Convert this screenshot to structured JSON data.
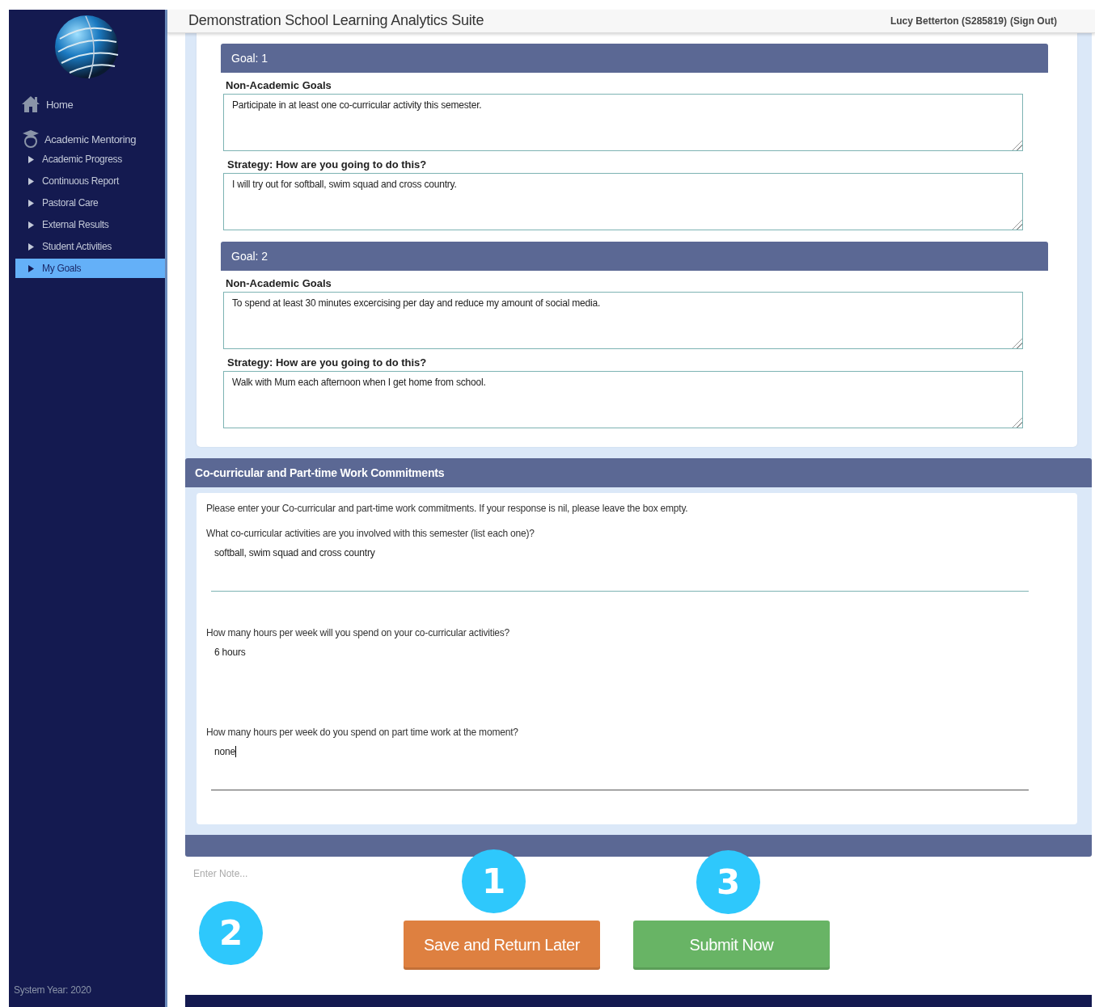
{
  "sidebar": {
    "items": [
      {
        "label": "Home",
        "kind": "home",
        "selected": false
      },
      {
        "label": "Academic Mentoring",
        "kind": "section",
        "selected": false
      },
      {
        "label": "Academic Progress",
        "kind": "sub",
        "selected": false
      },
      {
        "label": "Continuous Report",
        "kind": "sub",
        "selected": false
      },
      {
        "label": "Pastoral Care",
        "kind": "sub",
        "selected": false
      },
      {
        "label": "External Results",
        "kind": "sub",
        "selected": false
      },
      {
        "label": "Student Activities",
        "kind": "sub",
        "selected": false
      },
      {
        "label": "My Goals",
        "kind": "sub",
        "selected": true
      }
    ],
    "footer": "System Year: 2020"
  },
  "header": {
    "title": "Demonstration School Learning Analytics Suite",
    "user": "Lucy Betterton (S285819)",
    "sign_out": "Sign Out",
    "paren_open": "(",
    "paren_close": ")"
  },
  "goals": [
    {
      "title": "Goal: 1",
      "fields": [
        {
          "label": "Non-Academic Goals",
          "value": "Participate in at least one co-curricular activity this semester."
        },
        {
          "label": "Strategy: How are you going to do this?",
          "value": "I will try out for softball, swim squad and cross country."
        }
      ]
    },
    {
      "title": "Goal: 2",
      "fields": [
        {
          "label": "Non-Academic Goals",
          "value": "To spend at least 30 minutes excercising per day and reduce my amount of social media."
        },
        {
          "label": "Strategy: How are you going to do this?",
          "value": "Walk with Mum each afternoon when I get home from school."
        }
      ]
    }
  ],
  "commitments": {
    "title": "Co-curricular and Part-time Work Commitments",
    "intro": "Please enter your Co-curricular and part-time work commitments. If your response is nil, please leave the box empty.",
    "questions": [
      {
        "question": "What co-curricular activities are you involved with this semester (list each one)?",
        "answer": "softball, swim squad and cross country",
        "focused": false,
        "underline": true
      },
      {
        "question": "How many hours per week will you spend on your co-curricular activities?",
        "answer": "6 hours",
        "focused": false,
        "underline": false
      },
      {
        "question": "How many hours per week do you spend on part time work at the moment?",
        "answer": "none",
        "focused": true,
        "underline": true
      }
    ]
  },
  "note": {
    "placeholder": "Enter Note..."
  },
  "buttons": [
    {
      "label": "Save and Return Later",
      "kind": "save"
    },
    {
      "label": "Submit Now",
      "kind": "submit"
    }
  ],
  "callouts": [
    {
      "label": "1"
    },
    {
      "label": "2"
    },
    {
      "label": "3"
    }
  ]
}
